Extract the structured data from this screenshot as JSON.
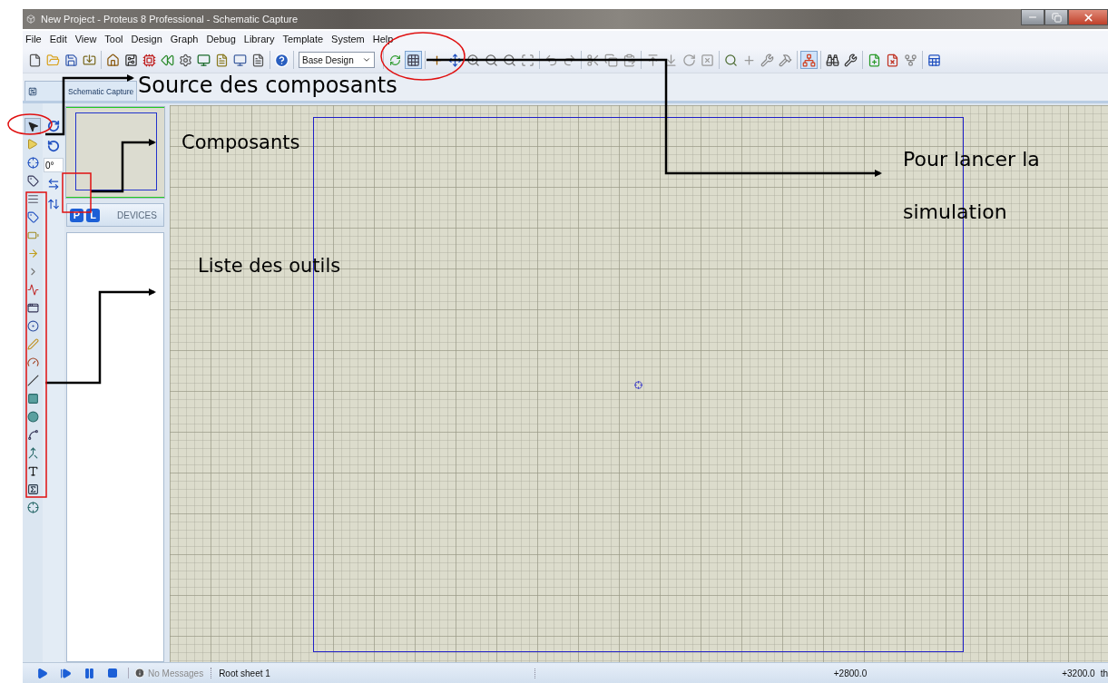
{
  "window": {
    "title": "New Project - Proteus 8 Professional - Schematic Capture"
  },
  "menu": [
    "File",
    "Edit",
    "View",
    "Tool",
    "Design",
    "Graph",
    "Debug",
    "Library",
    "Template",
    "System",
    "Help"
  ],
  "toolbar": {
    "design_dropdown": "Base Design"
  },
  "tabs": [
    {
      "label": "Schematic Capture",
      "selected": true
    }
  ],
  "mode_panel": {
    "rotation": "0°"
  },
  "devices_panel": {
    "buttons": [
      "P",
      "L"
    ],
    "title": "DEVICES"
  },
  "status_bar": {
    "messages": "No Messages",
    "sheet": "Root sheet 1",
    "x_coord": "+2800.0",
    "y_coord": "+3200.0",
    "unit": "th"
  },
  "annotations": [
    {
      "lines": [
        "Source des composants"
      ]
    },
    {
      "lines": [
        "Composants"
      ]
    },
    {
      "lines": [
        "Pour lancer la",
        "simulation"
      ]
    },
    {
      "lines": [
        "Liste des outils"
      ]
    }
  ]
}
